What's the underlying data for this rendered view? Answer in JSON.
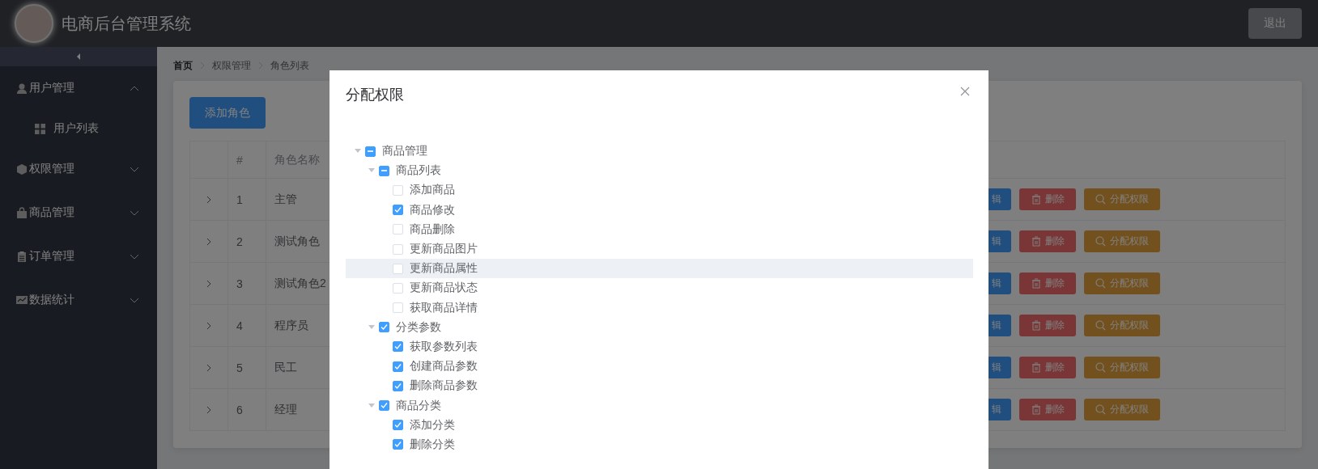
{
  "header": {
    "title": "电商后台管理系统",
    "logout": "退出"
  },
  "sidebar": {
    "items": [
      {
        "label": "用户管理",
        "expanded": true,
        "children": [
          {
            "label": "用户列表"
          }
        ]
      },
      {
        "label": "权限管理",
        "expanded": false
      },
      {
        "label": "商品管理",
        "expanded": false
      },
      {
        "label": "订单管理",
        "expanded": false
      },
      {
        "label": "数据统计",
        "expanded": false
      }
    ]
  },
  "breadcrumb": [
    "首页",
    "权限管理",
    "角色列表"
  ],
  "add_button": "添加角色",
  "table": {
    "columns": [
      "#",
      "角色名称"
    ],
    "rows": [
      {
        "index": "1",
        "name": "主管",
        "actions": [
          {
            "kind": "edit",
            "label": "辑"
          },
          {
            "kind": "delete",
            "label": "删除"
          },
          {
            "kind": "assign",
            "label": "分配权限"
          }
        ]
      },
      {
        "index": "2",
        "name": "测试角色",
        "actions": [
          {
            "kind": "edit",
            "label": "辑"
          },
          {
            "kind": "delete",
            "label": "删除"
          },
          {
            "kind": "assign",
            "label": "分配权限"
          }
        ]
      },
      {
        "index": "3",
        "name": "测试角色2",
        "actions": [
          {
            "kind": "edit",
            "label": "辑"
          },
          {
            "kind": "delete",
            "label": "删除"
          },
          {
            "kind": "assign",
            "label": "分配权限"
          }
        ]
      },
      {
        "index": "4",
        "name": "程序员",
        "actions": [
          {
            "kind": "edit",
            "label": "辑"
          },
          {
            "kind": "delete",
            "label": "删除"
          },
          {
            "kind": "assign",
            "label": "分配权限"
          }
        ]
      },
      {
        "index": "5",
        "name": "民工",
        "actions": [
          {
            "kind": "edit",
            "label": "辑"
          },
          {
            "kind": "delete",
            "label": "删除"
          },
          {
            "kind": "assign",
            "label": "分配权限"
          }
        ]
      },
      {
        "index": "6",
        "name": "经理",
        "actions": [
          {
            "kind": "edit",
            "label": "辑"
          },
          {
            "kind": "delete",
            "label": "删除"
          },
          {
            "kind": "assign",
            "label": "分配权限"
          }
        ]
      }
    ]
  },
  "dialog": {
    "title": "分配权限",
    "tree": [
      {
        "label": "商品管理",
        "checked": false,
        "indeterminate": true,
        "expanded": true,
        "children": [
          {
            "label": "商品列表",
            "checked": false,
            "indeterminate": true,
            "expanded": true,
            "children": [
              {
                "label": "添加商品",
                "checked": false,
                "hovered": false
              },
              {
                "label": "商品修改",
                "checked": true,
                "hovered": false
              },
              {
                "label": "商品删除",
                "checked": false,
                "hovered": false
              },
              {
                "label": "更新商品图片",
                "checked": false,
                "hovered": false
              },
              {
                "label": "更新商品属性",
                "checked": false,
                "hovered": true
              },
              {
                "label": "更新商品状态",
                "checked": false,
                "hovered": false
              },
              {
                "label": "获取商品详情",
                "checked": false,
                "hovered": false
              }
            ]
          },
          {
            "label": "分类参数",
            "checked": true,
            "indeterminate": false,
            "expanded": true,
            "children": [
              {
                "label": "获取参数列表",
                "checked": true,
                "hovered": false
              },
              {
                "label": "创建商品参数",
                "checked": true,
                "hovered": false
              },
              {
                "label": "删除商品参数",
                "checked": true,
                "hovered": false
              }
            ]
          },
          {
            "label": "商品分类",
            "checked": true,
            "indeterminate": false,
            "expanded": true,
            "children": [
              {
                "label": "添加分类",
                "checked": true,
                "hovered": false
              },
              {
                "label": "删除分类",
                "checked": true,
                "hovered": false
              }
            ]
          }
        ]
      }
    ]
  }
}
